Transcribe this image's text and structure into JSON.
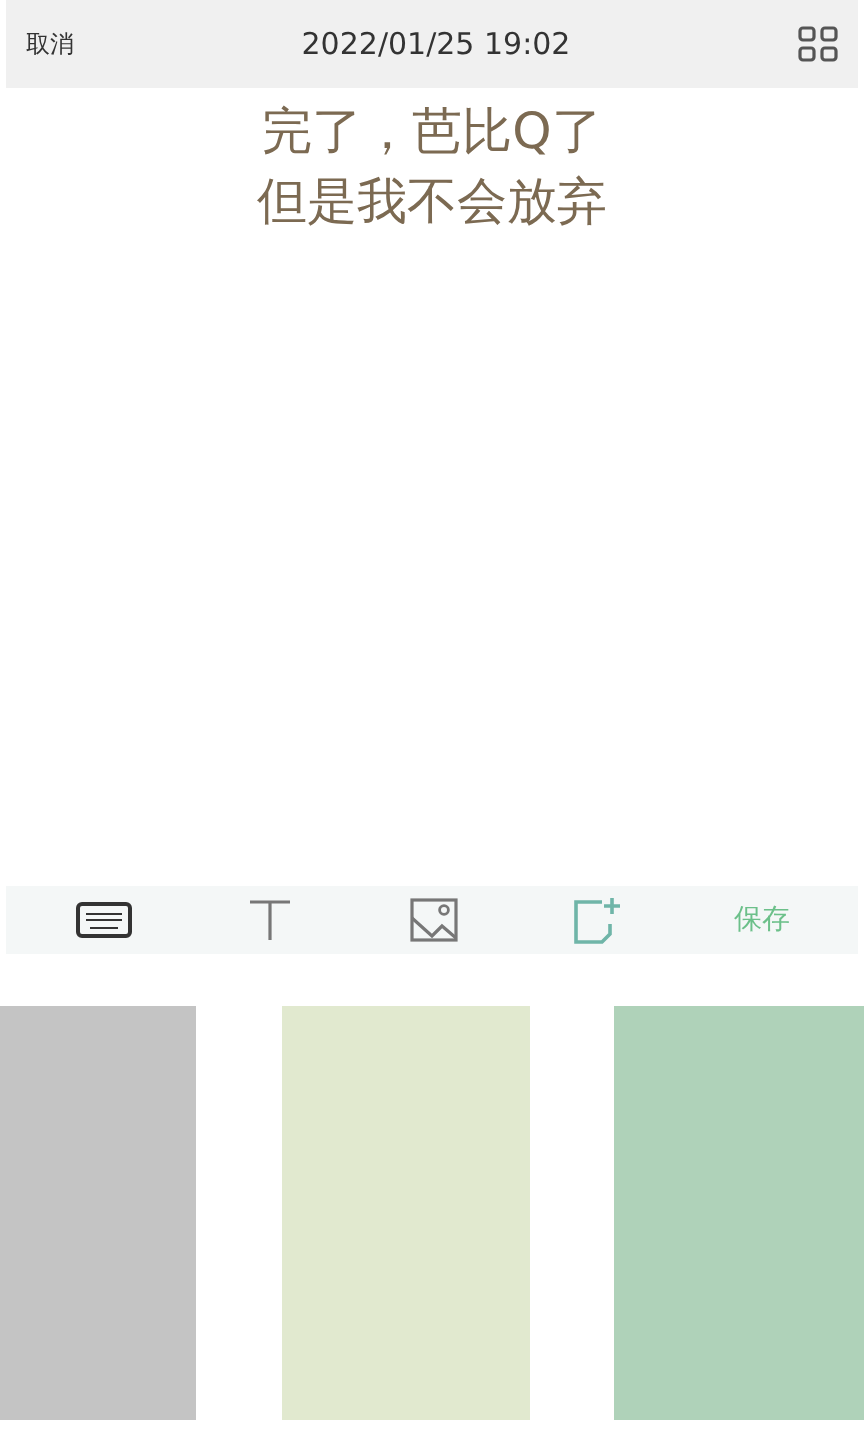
{
  "header": {
    "cancel": "取消",
    "datetime": "2022/01/25 19:02"
  },
  "note": {
    "lines": [
      "完了，芭比Q了",
      "但是我不会放弃"
    ]
  },
  "toolbar": {
    "tools": [
      {
        "kind": "keyboard",
        "selected": false
      },
      {
        "kind": "text",
        "selected": false
      },
      {
        "kind": "image",
        "selected": false
      },
      {
        "kind": "sticker",
        "selected": true
      }
    ],
    "save": "保存"
  },
  "swatches": [
    {
      "color": "#c4c4c4"
    },
    {
      "color": "#e1e9cf"
    },
    {
      "color": "#afd2b9"
    }
  ]
}
